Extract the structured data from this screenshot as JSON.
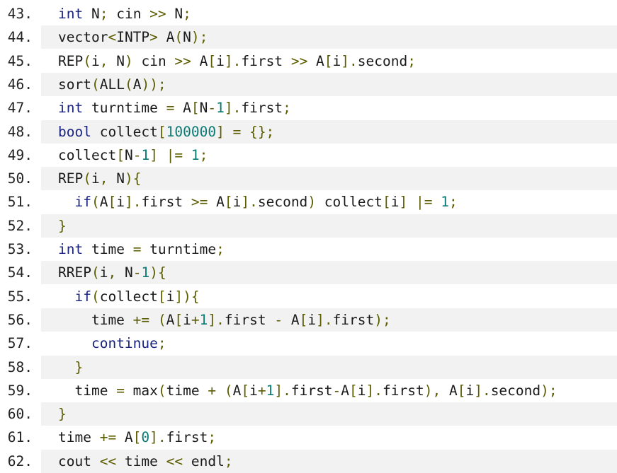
{
  "colors": {
    "line_shade": "#f2f2f2",
    "keyword": "#1a237e",
    "punctuation": "#5c5c00",
    "number": "#0a7a72",
    "text": "#1a1a1a"
  },
  "lines": [
    {
      "no": "43.",
      "tokens": [
        [
          "kw",
          "int"
        ],
        [
          "t",
          " N"
        ],
        [
          "p",
          ";"
        ],
        [
          "t",
          " cin "
        ],
        [
          "p",
          ">>"
        ],
        [
          "t",
          " N"
        ],
        [
          "p",
          ";"
        ]
      ]
    },
    {
      "no": "44.",
      "tokens": [
        [
          "t",
          "vector"
        ],
        [
          "p",
          "<"
        ],
        [
          "t",
          "INTP"
        ],
        [
          "p",
          ">"
        ],
        [
          "t",
          " A"
        ],
        [
          "p",
          "("
        ],
        [
          "t",
          "N"
        ],
        [
          "p",
          ");"
        ]
      ]
    },
    {
      "no": "45.",
      "tokens": [
        [
          "t",
          "REP"
        ],
        [
          "p",
          "("
        ],
        [
          "t",
          "i"
        ],
        [
          "p",
          ","
        ],
        [
          "t",
          " N"
        ],
        [
          "p",
          ")"
        ],
        [
          "t",
          " cin "
        ],
        [
          "p",
          ">>"
        ],
        [
          "t",
          " A"
        ],
        [
          "p",
          "["
        ],
        [
          "t",
          "i"
        ],
        [
          "p",
          "]."
        ],
        [
          "t",
          "first "
        ],
        [
          "p",
          ">>"
        ],
        [
          "t",
          " A"
        ],
        [
          "p",
          "["
        ],
        [
          "t",
          "i"
        ],
        [
          "p",
          "]."
        ],
        [
          "t",
          "second"
        ],
        [
          "p",
          ";"
        ]
      ]
    },
    {
      "no": "46.",
      "tokens": [
        [
          "t",
          "sort"
        ],
        [
          "p",
          "("
        ],
        [
          "t",
          "ALL"
        ],
        [
          "p",
          "("
        ],
        [
          "t",
          "A"
        ],
        [
          "p",
          "));"
        ]
      ]
    },
    {
      "no": "47.",
      "tokens": [
        [
          "kw",
          "int"
        ],
        [
          "t",
          " turntime "
        ],
        [
          "p",
          "="
        ],
        [
          "t",
          " A"
        ],
        [
          "p",
          "["
        ],
        [
          "t",
          "N"
        ],
        [
          "p",
          "-"
        ],
        [
          "n",
          "1"
        ],
        [
          "p",
          "]."
        ],
        [
          "t",
          "first"
        ],
        [
          "p",
          ";"
        ]
      ]
    },
    {
      "no": "48.",
      "tokens": [
        [
          "kw",
          "bool"
        ],
        [
          "t",
          " collect"
        ],
        [
          "p",
          "["
        ],
        [
          "n",
          "100000"
        ],
        [
          "p",
          "]"
        ],
        [
          "t",
          " "
        ],
        [
          "p",
          "= {};"
        ]
      ]
    },
    {
      "no": "49.",
      "tokens": [
        [
          "t",
          "collect"
        ],
        [
          "p",
          "["
        ],
        [
          "t",
          "N"
        ],
        [
          "p",
          "-"
        ],
        [
          "n",
          "1"
        ],
        [
          "p",
          "]"
        ],
        [
          "t",
          " "
        ],
        [
          "p",
          "|="
        ],
        [
          "t",
          " "
        ],
        [
          "n",
          "1"
        ],
        [
          "p",
          ";"
        ]
      ]
    },
    {
      "no": "50.",
      "tokens": [
        [
          "t",
          "REP"
        ],
        [
          "p",
          "("
        ],
        [
          "t",
          "i"
        ],
        [
          "p",
          ","
        ],
        [
          "t",
          " N"
        ],
        [
          "p",
          "){"
        ]
      ]
    },
    {
      "no": "51.",
      "tokens": [
        [
          "t",
          "  "
        ],
        [
          "kw",
          "if"
        ],
        [
          "p",
          "("
        ],
        [
          "t",
          "A"
        ],
        [
          "p",
          "["
        ],
        [
          "t",
          "i"
        ],
        [
          "p",
          "]."
        ],
        [
          "t",
          "first "
        ],
        [
          "p",
          ">="
        ],
        [
          "t",
          " A"
        ],
        [
          "p",
          "["
        ],
        [
          "t",
          "i"
        ],
        [
          "p",
          "]."
        ],
        [
          "t",
          "second"
        ],
        [
          "p",
          ")"
        ],
        [
          "t",
          " collect"
        ],
        [
          "p",
          "["
        ],
        [
          "t",
          "i"
        ],
        [
          "p",
          "]"
        ],
        [
          "t",
          " "
        ],
        [
          "p",
          "|="
        ],
        [
          "t",
          " "
        ],
        [
          "n",
          "1"
        ],
        [
          "p",
          ";"
        ]
      ]
    },
    {
      "no": "52.",
      "tokens": [
        [
          "p",
          "}"
        ]
      ]
    },
    {
      "no": "53.",
      "tokens": [
        [
          "kw",
          "int"
        ],
        [
          "t",
          " time "
        ],
        [
          "p",
          "="
        ],
        [
          "t",
          " turntime"
        ],
        [
          "p",
          ";"
        ]
      ]
    },
    {
      "no": "54.",
      "tokens": [
        [
          "t",
          "RREP"
        ],
        [
          "p",
          "("
        ],
        [
          "t",
          "i"
        ],
        [
          "p",
          ","
        ],
        [
          "t",
          " N"
        ],
        [
          "p",
          "-"
        ],
        [
          "n",
          "1"
        ],
        [
          "p",
          "){"
        ]
      ]
    },
    {
      "no": "55.",
      "tokens": [
        [
          "t",
          "  "
        ],
        [
          "kw",
          "if"
        ],
        [
          "p",
          "("
        ],
        [
          "t",
          "collect"
        ],
        [
          "p",
          "["
        ],
        [
          "t",
          "i"
        ],
        [
          "p",
          "]){"
        ]
      ]
    },
    {
      "no": "56.",
      "tokens": [
        [
          "t",
          "    time "
        ],
        [
          "p",
          "+="
        ],
        [
          "t",
          " "
        ],
        [
          "p",
          "("
        ],
        [
          "t",
          "A"
        ],
        [
          "p",
          "["
        ],
        [
          "t",
          "i"
        ],
        [
          "p",
          "+"
        ],
        [
          "n",
          "1"
        ],
        [
          "p",
          "]."
        ],
        [
          "t",
          "first "
        ],
        [
          "p",
          "-"
        ],
        [
          "t",
          " A"
        ],
        [
          "p",
          "["
        ],
        [
          "t",
          "i"
        ],
        [
          "p",
          "]."
        ],
        [
          "t",
          "first"
        ],
        [
          "p",
          ");"
        ]
      ]
    },
    {
      "no": "57.",
      "tokens": [
        [
          "t",
          "    "
        ],
        [
          "kw",
          "continue"
        ],
        [
          "p",
          ";"
        ]
      ]
    },
    {
      "no": "58.",
      "tokens": [
        [
          "t",
          "  "
        ],
        [
          "p",
          "}"
        ]
      ]
    },
    {
      "no": "59.",
      "tokens": [
        [
          "t",
          "  time "
        ],
        [
          "p",
          "="
        ],
        [
          "t",
          " max"
        ],
        [
          "p",
          "("
        ],
        [
          "t",
          "time "
        ],
        [
          "p",
          "+"
        ],
        [
          "t",
          " "
        ],
        [
          "p",
          "("
        ],
        [
          "t",
          "A"
        ],
        [
          "p",
          "["
        ],
        [
          "t",
          "i"
        ],
        [
          "p",
          "+"
        ],
        [
          "n",
          "1"
        ],
        [
          "p",
          "]."
        ],
        [
          "t",
          "first"
        ],
        [
          "p",
          "-"
        ],
        [
          "t",
          "A"
        ],
        [
          "p",
          "["
        ],
        [
          "t",
          "i"
        ],
        [
          "p",
          "]."
        ],
        [
          "t",
          "first"
        ],
        [
          "p",
          "),"
        ],
        [
          "t",
          " A"
        ],
        [
          "p",
          "["
        ],
        [
          "t",
          "i"
        ],
        [
          "p",
          "]."
        ],
        [
          "t",
          "second"
        ],
        [
          "p",
          ");"
        ]
      ]
    },
    {
      "no": "60.",
      "tokens": [
        [
          "p",
          "}"
        ]
      ]
    },
    {
      "no": "61.",
      "tokens": [
        [
          "t",
          "time "
        ],
        [
          "p",
          "+="
        ],
        [
          "t",
          " A"
        ],
        [
          "p",
          "["
        ],
        [
          "n",
          "0"
        ],
        [
          "p",
          "]."
        ],
        [
          "t",
          "first"
        ],
        [
          "p",
          ";"
        ]
      ]
    },
    {
      "no": "62.",
      "tokens": [
        [
          "t",
          "cout "
        ],
        [
          "p",
          "<<"
        ],
        [
          "t",
          " time "
        ],
        [
          "p",
          "<<"
        ],
        [
          "t",
          " endl"
        ],
        [
          "p",
          ";"
        ]
      ]
    }
  ]
}
